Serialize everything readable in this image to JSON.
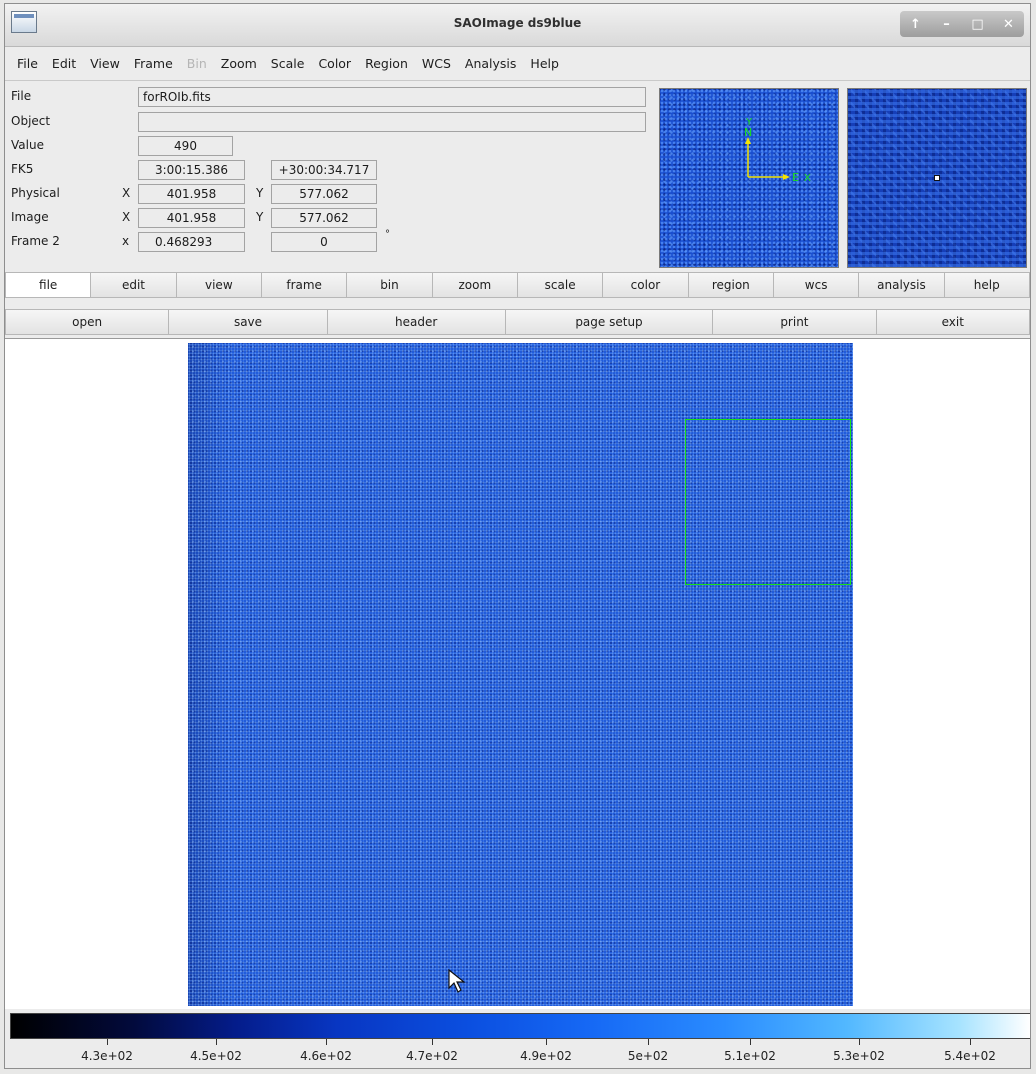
{
  "window": {
    "title": "SAOImage ds9blue",
    "controls": [
      "↑",
      "–",
      "□",
      "✕"
    ]
  },
  "menubar": {
    "items": [
      {
        "label": "File",
        "enabled": true
      },
      {
        "label": "Edit",
        "enabled": true
      },
      {
        "label": "View",
        "enabled": true
      },
      {
        "label": "Frame",
        "enabled": true
      },
      {
        "label": "Bin",
        "enabled": false
      },
      {
        "label": "Zoom",
        "enabled": true
      },
      {
        "label": "Scale",
        "enabled": true
      },
      {
        "label": "Color",
        "enabled": true
      },
      {
        "label": "Region",
        "enabled": true
      },
      {
        "label": "WCS",
        "enabled": true
      },
      {
        "label": "Analysis",
        "enabled": true
      },
      {
        "label": "Help",
        "enabled": true
      }
    ]
  },
  "info": {
    "file_label": "File",
    "file_value": "forROIb.fits",
    "object_label": "Object",
    "object_value": "",
    "value_label": "Value",
    "value_value": "490",
    "fk5_label": "FK5",
    "fk5_ra": "3:00:15.386",
    "fk5_dec": "+30:00:34.717",
    "physical_label": "Physical",
    "physical_x_label": "X",
    "physical_x": "401.958",
    "physical_y_label": "Y",
    "physical_y": "577.062",
    "image_label": "Image",
    "image_x_label": "X",
    "image_x": "401.958",
    "image_y_label": "Y",
    "image_y": "577.062",
    "frame_label": "Frame 2",
    "frame_x_label": "x",
    "frame_zoom": "0.468293",
    "frame_angle": "0",
    "frame_degree": "°"
  },
  "compass": {
    "north": "N",
    "east": "E",
    "x": "X",
    "y": "Y"
  },
  "buttonbar": {
    "items": [
      "file",
      "edit",
      "view",
      "frame",
      "bin",
      "zoom",
      "scale",
      "color",
      "region",
      "wcs",
      "analysis",
      "help"
    ],
    "active": "file"
  },
  "subbar": {
    "items": [
      "open",
      "save",
      "header",
      "page setup",
      "print",
      "exit"
    ]
  },
  "colorbar": {
    "ticks": [
      "4.3e+02",
      "4.5e+02",
      "4.6e+02",
      "4.7e+02",
      "4.9e+02",
      "5e+02",
      "5.1e+02",
      "5.3e+02",
      "5.4e+02"
    ]
  },
  "colors": {
    "roi_box": "#19e019",
    "compass_axes": "#f5e400",
    "compass_labels": "#19e019",
    "image_base": "#1a55d8"
  }
}
